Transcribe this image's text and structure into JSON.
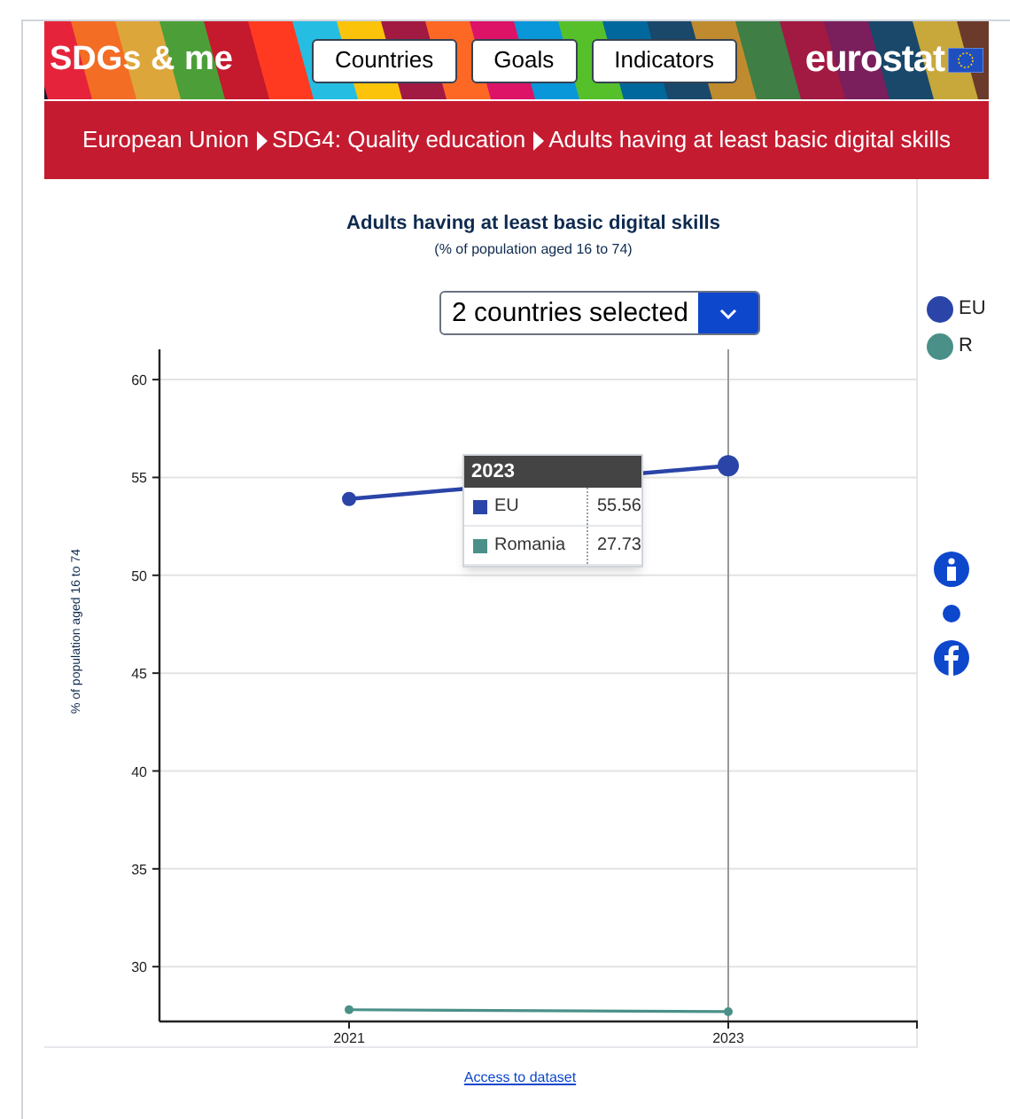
{
  "header": {
    "logo": "SDGs & me",
    "nav": [
      {
        "label": "Countries"
      },
      {
        "label": "Goals"
      },
      {
        "label": "Indicators"
      }
    ],
    "brand": "eurostat"
  },
  "breadcrumb": [
    "European Union",
    "SDG4: Quality education",
    "Adults having at least basic digital skills"
  ],
  "chart_title": "Adults having at least basic digital skills",
  "chart_subtitle": "(% of population aged 16 to 74)",
  "country_select": {
    "value": "2 countries selected",
    "expanded": false
  },
  "legend": [
    {
      "label": "EU",
      "color": "#2a44a8"
    },
    {
      "label": "R",
      "color": "#4a9088"
    }
  ],
  "chart": {
    "chart_data": {
      "type": "line",
      "ylabel": "% of population aged 16 to 74",
      "x": [
        2021,
        2023
      ],
      "xticks": [
        2021,
        2023
      ],
      "yticks": [
        30,
        35,
        40,
        45,
        50,
        55,
        60
      ],
      "xlim": [
        2020,
        2024
      ],
      "ylim": [
        27.2,
        61.5
      ],
      "grid": true,
      "ref_lines": [
        {
          "axis": "x",
          "value": 2023
        }
      ],
      "series": [
        {
          "name": "EU",
          "color": "#2a44a8",
          "marker": true,
          "values": [
            53.9,
            55.6
          ]
        },
        {
          "name": "Romania",
          "color": "#4a9088",
          "marker": true,
          "values": [
            27.8,
            27.7
          ]
        }
      ]
    }
  },
  "tooltip": {
    "title": "2023",
    "rows": [
      {
        "value": "55.56"
      },
      {
        "value": "27.73"
      }
    ]
  },
  "dataset_link": "Access to dataset"
}
